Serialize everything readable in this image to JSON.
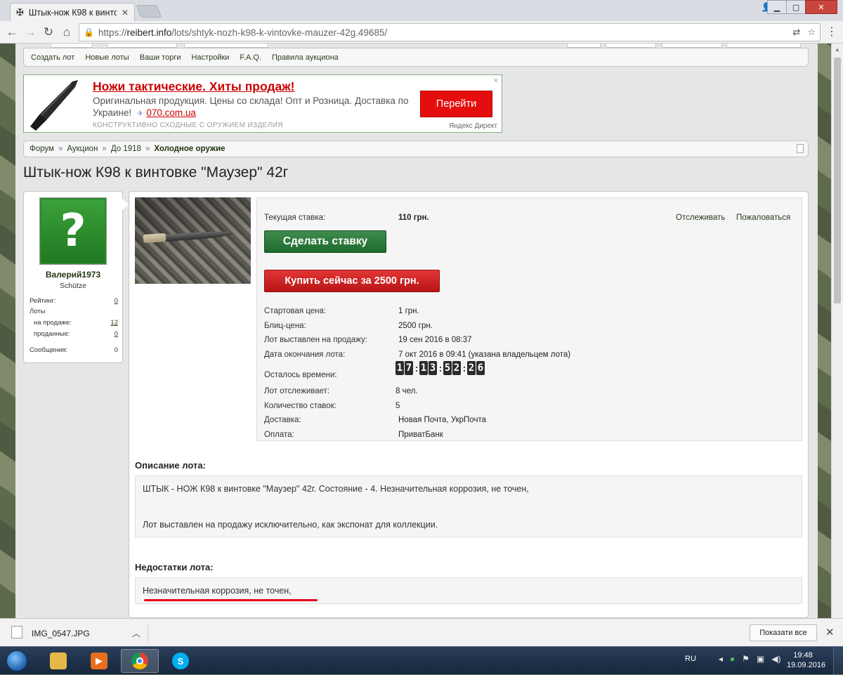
{
  "browser": {
    "tab_title": "Штык-нож К98 к винтов",
    "url_scheme": "https://",
    "url_domain": "reibert.info",
    "url_path": "/lots/shtyk-nozh-k98-k-vintovke-mauzer-42g.49685/"
  },
  "subnav": [
    "Создать лот",
    "Новые лоты",
    "Ваши торги",
    "Настройки",
    "F.A.Q.",
    "Правила аукциона"
  ],
  "ad": {
    "title": "Ножи тактические. Хиты продаж!",
    "text": "Оригинальная продукция. Цены со склада! Опт и Розница. Доставка по Украине!",
    "link": "070.com.ua",
    "disclaimer": "КОНСТРУКТИВНО СХОДНЫЕ С ОРУЖИЕМ ИЗДЕЛИЯ",
    "button": "Перейти",
    "source": "Яндекс Директ",
    "close": "×"
  },
  "breadcrumb": {
    "items": [
      "Форум",
      "Аукцион",
      "До 1918"
    ],
    "separator": "»",
    "current": "Холодное оружие"
  },
  "title": "Штык-нож К98 к винтовке \"Маузер\" 42г",
  "user": {
    "avatar_glyph": "?",
    "name": "Валерий1973",
    "title": "Schütze",
    "rating_label": "Рейтинг:",
    "rating_value": "0",
    "lots_label": "Лоты",
    "on_sale_label": "на продаже:",
    "on_sale_value": "12",
    "sold_label": "проданные:",
    "sold_value": "0",
    "messages_label": "Сообщения:",
    "messages_value": "0"
  },
  "lot": {
    "current_bid_label": "Текущая ставка:",
    "current_bid_value": "110 грн.",
    "track_link": "Отслеживать",
    "report_link": "Пожаловаться",
    "bid_button": "Сделать ставку",
    "buy_button": "Купить сейчас за 2500 грн.",
    "details": [
      {
        "label": "Стартовая цена:",
        "value": "1 грн."
      },
      {
        "label": "Блиц-цена:",
        "value": "2500 грн."
      },
      {
        "label": "Лот выставлен на продажу:",
        "value": "19 сен 2016 в 08:37"
      },
      {
        "label": "Дата окончания лота:",
        "value": "7 окт 2016 в 09:41 (указана владельцем лота)"
      }
    ],
    "time_left_label": "Осталось времени:",
    "timer": [
      "1",
      "7",
      "1",
      "3",
      "5",
      "2",
      "2",
      "6"
    ],
    "extra": [
      {
        "label": "Лот отслеживает:",
        "value": "8 чел."
      },
      {
        "label": "Количество ставок:",
        "value": "5"
      },
      {
        "label": "Доставка:",
        "value": "Новая Почта, УкрПочта"
      },
      {
        "label": "Оплата:",
        "value": "ПриватБанк"
      }
    ],
    "description_title": "Описание лота:",
    "description_line1": "ШТЫК - НОЖ К98 к винтовке \"Маузер\" 42г. Состояние - 4. Незначительная коррозия, не точен,",
    "description_line2": "Лот выставлен на продажу исключительно, как экспонат для коллекции.",
    "flaws_title": "Недостатки лота:",
    "flaws_text": "Незначительная коррозия, не точен,"
  },
  "downloads": {
    "file": "IMG_0547.JPG",
    "show_all": "Показати все"
  },
  "taskbar": {
    "lang": "RU",
    "time": "19:48",
    "date": "19.09.2016"
  }
}
